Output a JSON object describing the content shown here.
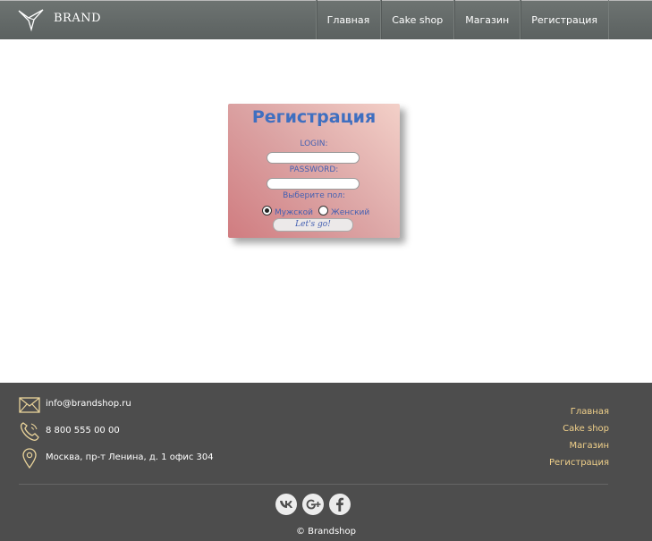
{
  "header": {
    "brand": "Brand",
    "nav": [
      {
        "label": "Главная"
      },
      {
        "label": "Cake shop"
      },
      {
        "label": "Магазин"
      },
      {
        "label": "Регистрация"
      }
    ]
  },
  "form": {
    "title": "Регистрация",
    "login_label": "LOGIN:",
    "login_value": "",
    "password_label": "PASSWORD:",
    "password_value": "",
    "gender_label": "Выберите пол:",
    "gender_options": [
      {
        "label": "Мужской",
        "checked": true
      },
      {
        "label": "Женский",
        "checked": false
      }
    ],
    "submit_label": "Let's go!"
  },
  "footer": {
    "email": "info@brandshop.ru",
    "phone": "8 800 555 00 00",
    "address": "Москва, пр-т Ленина, д. 1 офис 304",
    "links": [
      "Главная",
      "Cake shop",
      "Магазин",
      "Регистрация"
    ],
    "social": [
      "vk-icon",
      "google-plus-icon",
      "facebook-icon"
    ],
    "copyright": "© Brandshop"
  },
  "colors": {
    "header_bg": "#5e6463",
    "footer_bg": "#4d4d4d",
    "footer_link": "#f0d08a",
    "form_text": "#4460b2",
    "form_title": "#3f6fc0"
  }
}
